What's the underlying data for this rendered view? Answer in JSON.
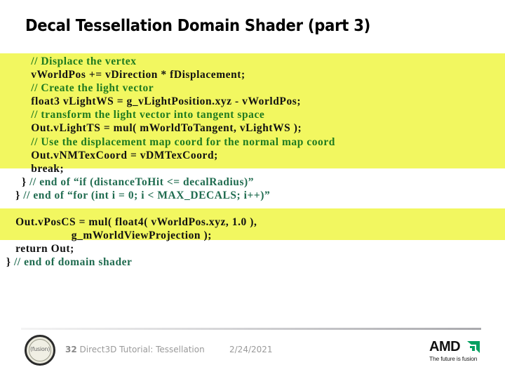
{
  "slide": {
    "title": "Decal Tessellation Domain Shader (part 3)",
    "highlight_color": "#f2f760",
    "comment_color": "#1f7a1f"
  },
  "code": {
    "block1": [
      {
        "indent": "          ",
        "text": "// Displace the vertex",
        "type": "comment"
      },
      {
        "indent": "          ",
        "text": "vWorldPos += vDirection * fDisplacement;",
        "type": "code"
      },
      {
        "indent": "          ",
        "text": "// Create the light vector",
        "type": "comment"
      },
      {
        "indent": "          ",
        "text": "float3 vLightWS = g_vLightPosition.xyz - vWorldPos;",
        "type": "code"
      },
      {
        "indent": "          ",
        "text": "// transform the light vector into tangent space",
        "type": "comment"
      },
      {
        "indent": "          ",
        "text": "Out.vLightTS = mul( mWorldToTangent, vLightWS );",
        "type": "code"
      },
      {
        "indent": "          ",
        "text": "// Use the displacement map coord for the normal map coord",
        "type": "comment"
      },
      {
        "indent": "          ",
        "text": "Out.vNMTexCoord = vDMTexCoord;",
        "type": "code"
      },
      {
        "indent": "          ",
        "text": "break;",
        "type": "code"
      }
    ],
    "end_if": {
      "brace": "       }",
      "comment": " // end of “if (distanceToHit <= decalRadius)”"
    },
    "end_for": {
      "brace": "     }",
      "comment": " // end of “for (int i = 0; i < MAX_DECALS; i++)”"
    },
    "block2": [
      "     Out.vPosCS = mul( float4( vWorldPos.xyz, 1.0 ),",
      "                       g_mWorldViewProjection );"
    ],
    "return_line": "     return Out;",
    "end_shader": {
      "brace": "  }",
      "comment": " // end of domain shader"
    }
  },
  "footer": {
    "logo_text": "(fusion)",
    "slide_number": "32",
    "course": " Direct3D Tutorial: Tessellation",
    "date": "2/24/2021",
    "brand": "AMD",
    "brand_color": "#00a060",
    "tagline": "The future is fusion"
  }
}
